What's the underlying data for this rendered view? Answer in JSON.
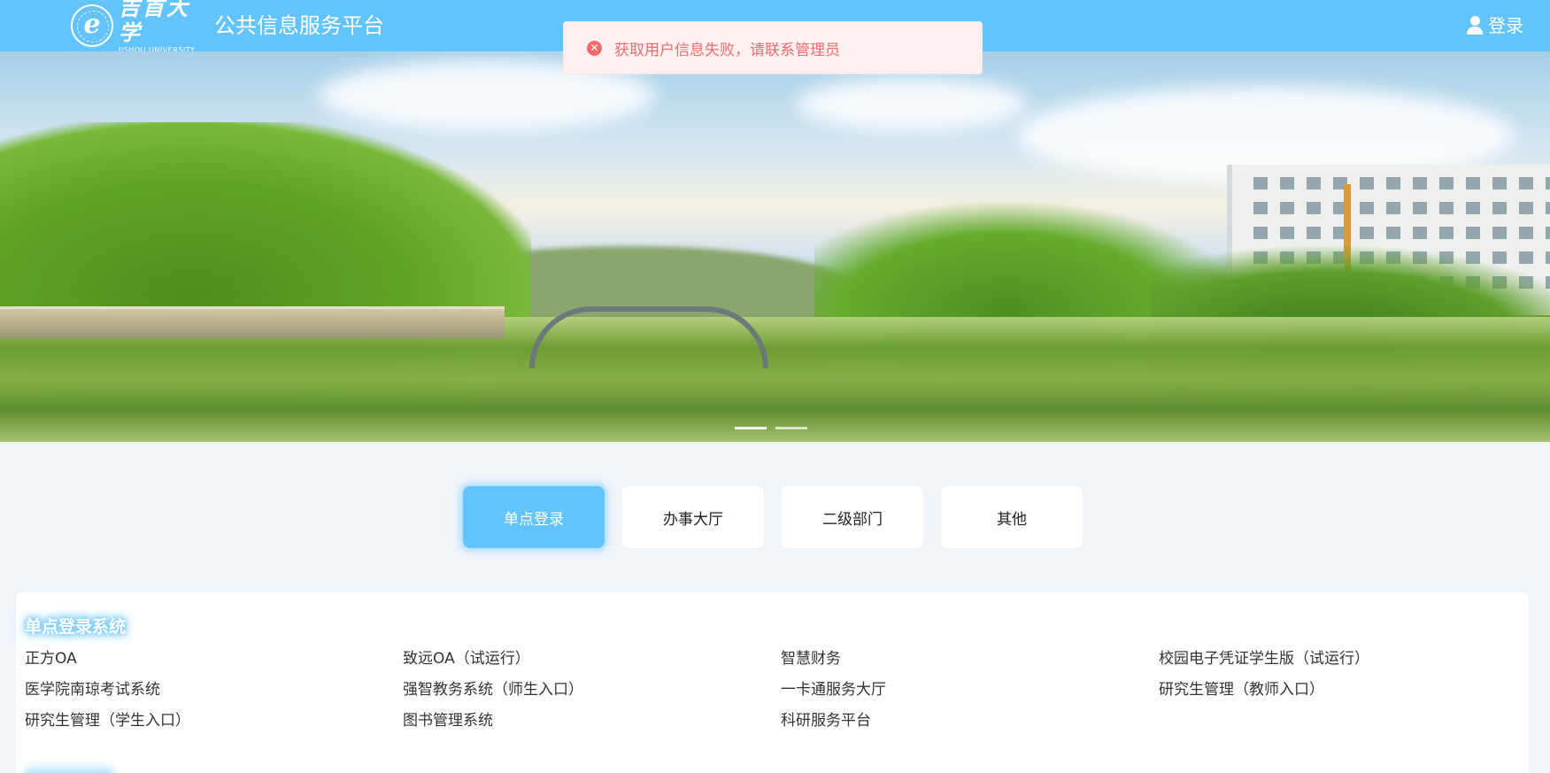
{
  "header": {
    "logo_cn": "吉首大学",
    "logo_en": "JISHOU UNIVERSITY",
    "platform_title": "公共信息服务平台",
    "login_label": "登录"
  },
  "toast": {
    "type": "error",
    "message": "获取用户信息失败，请联系管理员",
    "icon": "close-circle-icon",
    "color": "#f56c6c"
  },
  "banner": {
    "slides": 2,
    "active_slide": 1
  },
  "tabs": [
    {
      "label": "单点登录",
      "active": true
    },
    {
      "label": "办事大厅",
      "active": false
    },
    {
      "label": "二级部门",
      "active": false
    },
    {
      "label": "其他",
      "active": false
    }
  ],
  "section": {
    "title": "单点登录系统",
    "links": [
      "正方OA",
      "致远OA（试运行）",
      "智慧财务",
      "校园电子凭证学生版（试运行）",
      "医学院南琼考试系统",
      "强智教务系统（师生入口）",
      "一卡通服务大厅",
      "研究生管理（教师入口）",
      "研究生管理（学生入口）",
      "图书管理系统",
      "科研服务平台"
    ]
  },
  "colors": {
    "brand": "#63c3fc",
    "background": "#f0f5fa",
    "error": "#f56c6c"
  }
}
